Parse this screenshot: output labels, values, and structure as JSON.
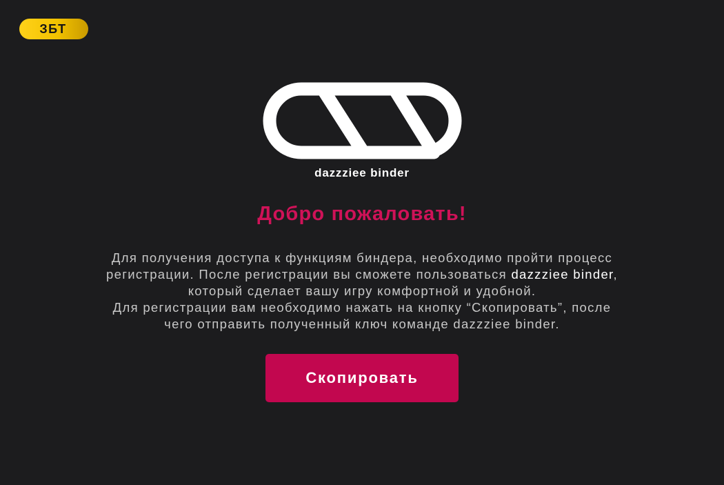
{
  "badge": {
    "label": "ЗБТ"
  },
  "logo": {
    "icon": "chain-links-logo-icon",
    "name": "dazzziee binder"
  },
  "welcome": {
    "title": "Добро пожаловать!"
  },
  "description": {
    "line1": "Для получения доступа к функциям биндера, необходимо пройти процесс",
    "line2_start": "регистрации. После регистрации вы сможете пользоваться ",
    "line2_highlight": "dazzziee binder",
    "line2_end": ",",
    "line3": "который сделает вашу игру комфортной и удобной.",
    "line4": "Для регистрации вам необходимо нажать на кнопку “Скопировать”, после",
    "line5": "чего отправить полученный ключ команде dazzziee binder."
  },
  "actions": {
    "copy_label": "Скопировать"
  },
  "colors": {
    "background": "#1c1c1e",
    "accent": "#c2074f",
    "title": "#cf1258",
    "badge": "#f2c200",
    "text": "#c8c8c8"
  }
}
